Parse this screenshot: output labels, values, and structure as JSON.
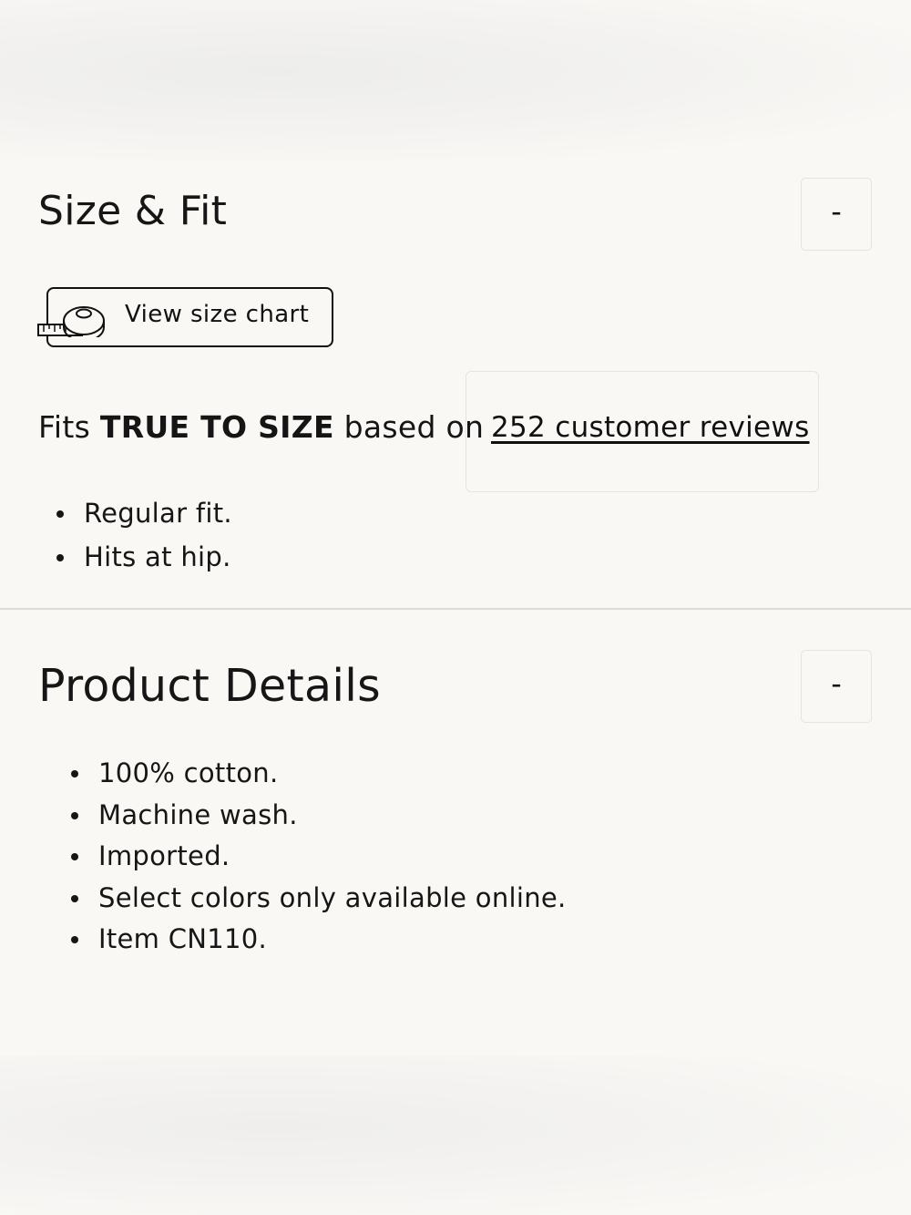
{
  "size_fit": {
    "title": "Size & Fit",
    "toggle_label": "-",
    "size_chart_label": "View size chart",
    "fits_prefix": "Fits",
    "fits_emphasis": "TRUE TO SIZE",
    "fits_suffix": "based on",
    "reviews_link": "252 customer reviews",
    "bullets": [
      "Regular fit.",
      "Hits at hip."
    ]
  },
  "product_details": {
    "title": "Product Details",
    "toggle_label": "-",
    "bullets": [
      "100% cotton.",
      "Machine wash.",
      "Imported.",
      "Select colors only available online.",
      "Item CN110."
    ]
  },
  "icons": {
    "size_chart": "measuring-tape-icon"
  }
}
